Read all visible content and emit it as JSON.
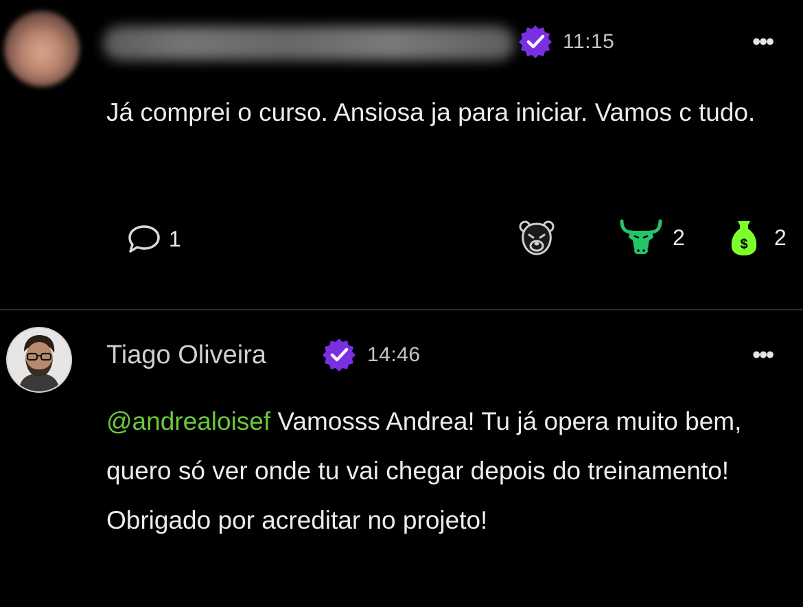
{
  "posts": [
    {
      "author": "",
      "time": "11:15",
      "body": "Já comprei o curso. Ansiosa ja para iniciar. Vamos c tudo.",
      "comment_count": "1",
      "reactions": [
        {
          "icon": "bear-icon",
          "count": ""
        },
        {
          "icon": "bull-icon",
          "count": "2"
        },
        {
          "icon": "money-bag-icon",
          "count": "2"
        }
      ],
      "more_label": "•••"
    },
    {
      "author": "Tiago Oliveira",
      "time": "14:46",
      "mention": "@andrealoisef",
      "body": " Vamosss Andrea! Tu já opera muito bem, quero só ver onde tu vai chegar depois do treinamento! Obrigado por acreditar no projeto!",
      "more_label": "•••"
    }
  ],
  "colors": {
    "background": "#000000",
    "verified_badge": "#7b2fe3",
    "mention": "#6bc93c",
    "bull_reaction": "#25c46b",
    "money_reaction": "#7dff2e"
  }
}
